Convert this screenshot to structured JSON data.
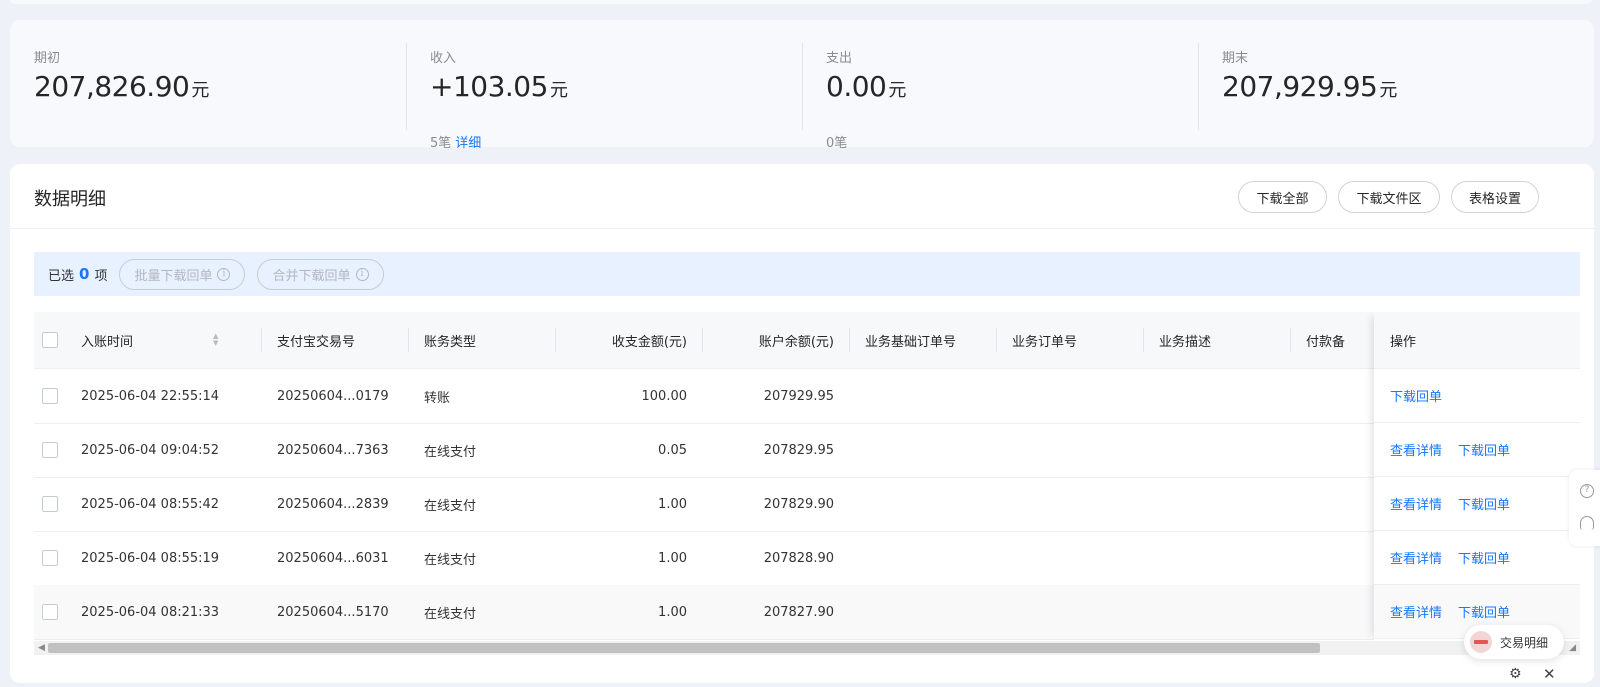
{
  "summary": [
    {
      "label": "期初",
      "value": "207,826.90",
      "unit": "元",
      "sub_text": "",
      "sub_link": ""
    },
    {
      "label": "收入",
      "value": "+103.05",
      "unit": "元",
      "sub_text": "5笔",
      "sub_link": "详细"
    },
    {
      "label": "支出",
      "value": "0.00",
      "unit": "元",
      "sub_text": "0笔",
      "sub_link": ""
    },
    {
      "label": "期末",
      "value": "207,929.95",
      "unit": "元",
      "sub_text": "",
      "sub_link": ""
    }
  ],
  "panel": {
    "title": "数据明细",
    "buttons": {
      "download_all": "下载全部",
      "download_area": "下载文件区",
      "table_settings": "表格设置"
    }
  },
  "selection": {
    "prefix": "已选",
    "count": "0",
    "suffix": "项",
    "batch_download": "批量下载回单",
    "merge_download": "合并下载回单"
  },
  "table": {
    "headers": {
      "time": "入账时间",
      "trade_no": "支付宝交易号",
      "type": "账务类型",
      "amount": "收支金额(元)",
      "balance": "账户余额(元)",
      "base_order": "业务基础订单号",
      "order": "业务订单号",
      "desc": "业务描述",
      "payer": "付款备",
      "ops": "操作"
    },
    "rows": [
      {
        "time": "2025-06-04 22:55:14",
        "trade_no": "20250604...0179",
        "type": "转账",
        "amount": "100.00",
        "balance": "207929.95",
        "ops": [
          "下载回单"
        ]
      },
      {
        "time": "2025-06-04 09:04:52",
        "trade_no": "20250604...7363",
        "type": "在线支付",
        "amount": "0.05",
        "balance": "207829.95",
        "ops": [
          "查看详情",
          "下载回单"
        ]
      },
      {
        "time": "2025-06-04 08:55:42",
        "trade_no": "20250604...2839",
        "type": "在线支付",
        "amount": "1.00",
        "balance": "207829.90",
        "ops": [
          "查看详情",
          "下载回单"
        ]
      },
      {
        "time": "2025-06-04 08:55:19",
        "trade_no": "20250604...6031",
        "type": "在线支付",
        "amount": "1.00",
        "balance": "207828.90",
        "ops": [
          "查看详情",
          "下载回单"
        ]
      },
      {
        "time": "2025-06-04 08:21:33",
        "trade_no": "20250604...5170",
        "type": "在线支付",
        "amount": "1.00",
        "balance": "207827.90",
        "ops": [
          "查看详情",
          "下载回单"
        ]
      }
    ]
  },
  "floating": {
    "chip_label": "交易明细"
  },
  "icons": {
    "help": "help-icon",
    "headset": "headset-icon",
    "settings": "gear-icon",
    "close": "close-icon"
  }
}
